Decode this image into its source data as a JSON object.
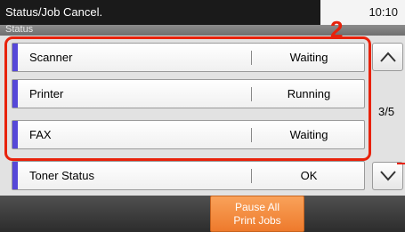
{
  "header": {
    "title": "Status/Job Cancel.",
    "time": "10:10",
    "subtitle": "Status"
  },
  "callout": {
    "marker": "2"
  },
  "rows": [
    {
      "name": "Scanner",
      "status": "Waiting"
    },
    {
      "name": "Printer",
      "status": "Running"
    },
    {
      "name": "FAX",
      "status": "Waiting"
    },
    {
      "name": "Toner Status",
      "status": "OK"
    }
  ],
  "scroll": {
    "page_indicator": "3/5",
    "up_icon": "chevron-up-icon",
    "down_icon": "chevron-down-icon"
  },
  "footer": {
    "pause_line1": "Pause All",
    "pause_line2": "Print Jobs"
  },
  "colors": {
    "accent": "#5648d8",
    "highlight": "#e8220b",
    "pause_button": "#f39046"
  }
}
